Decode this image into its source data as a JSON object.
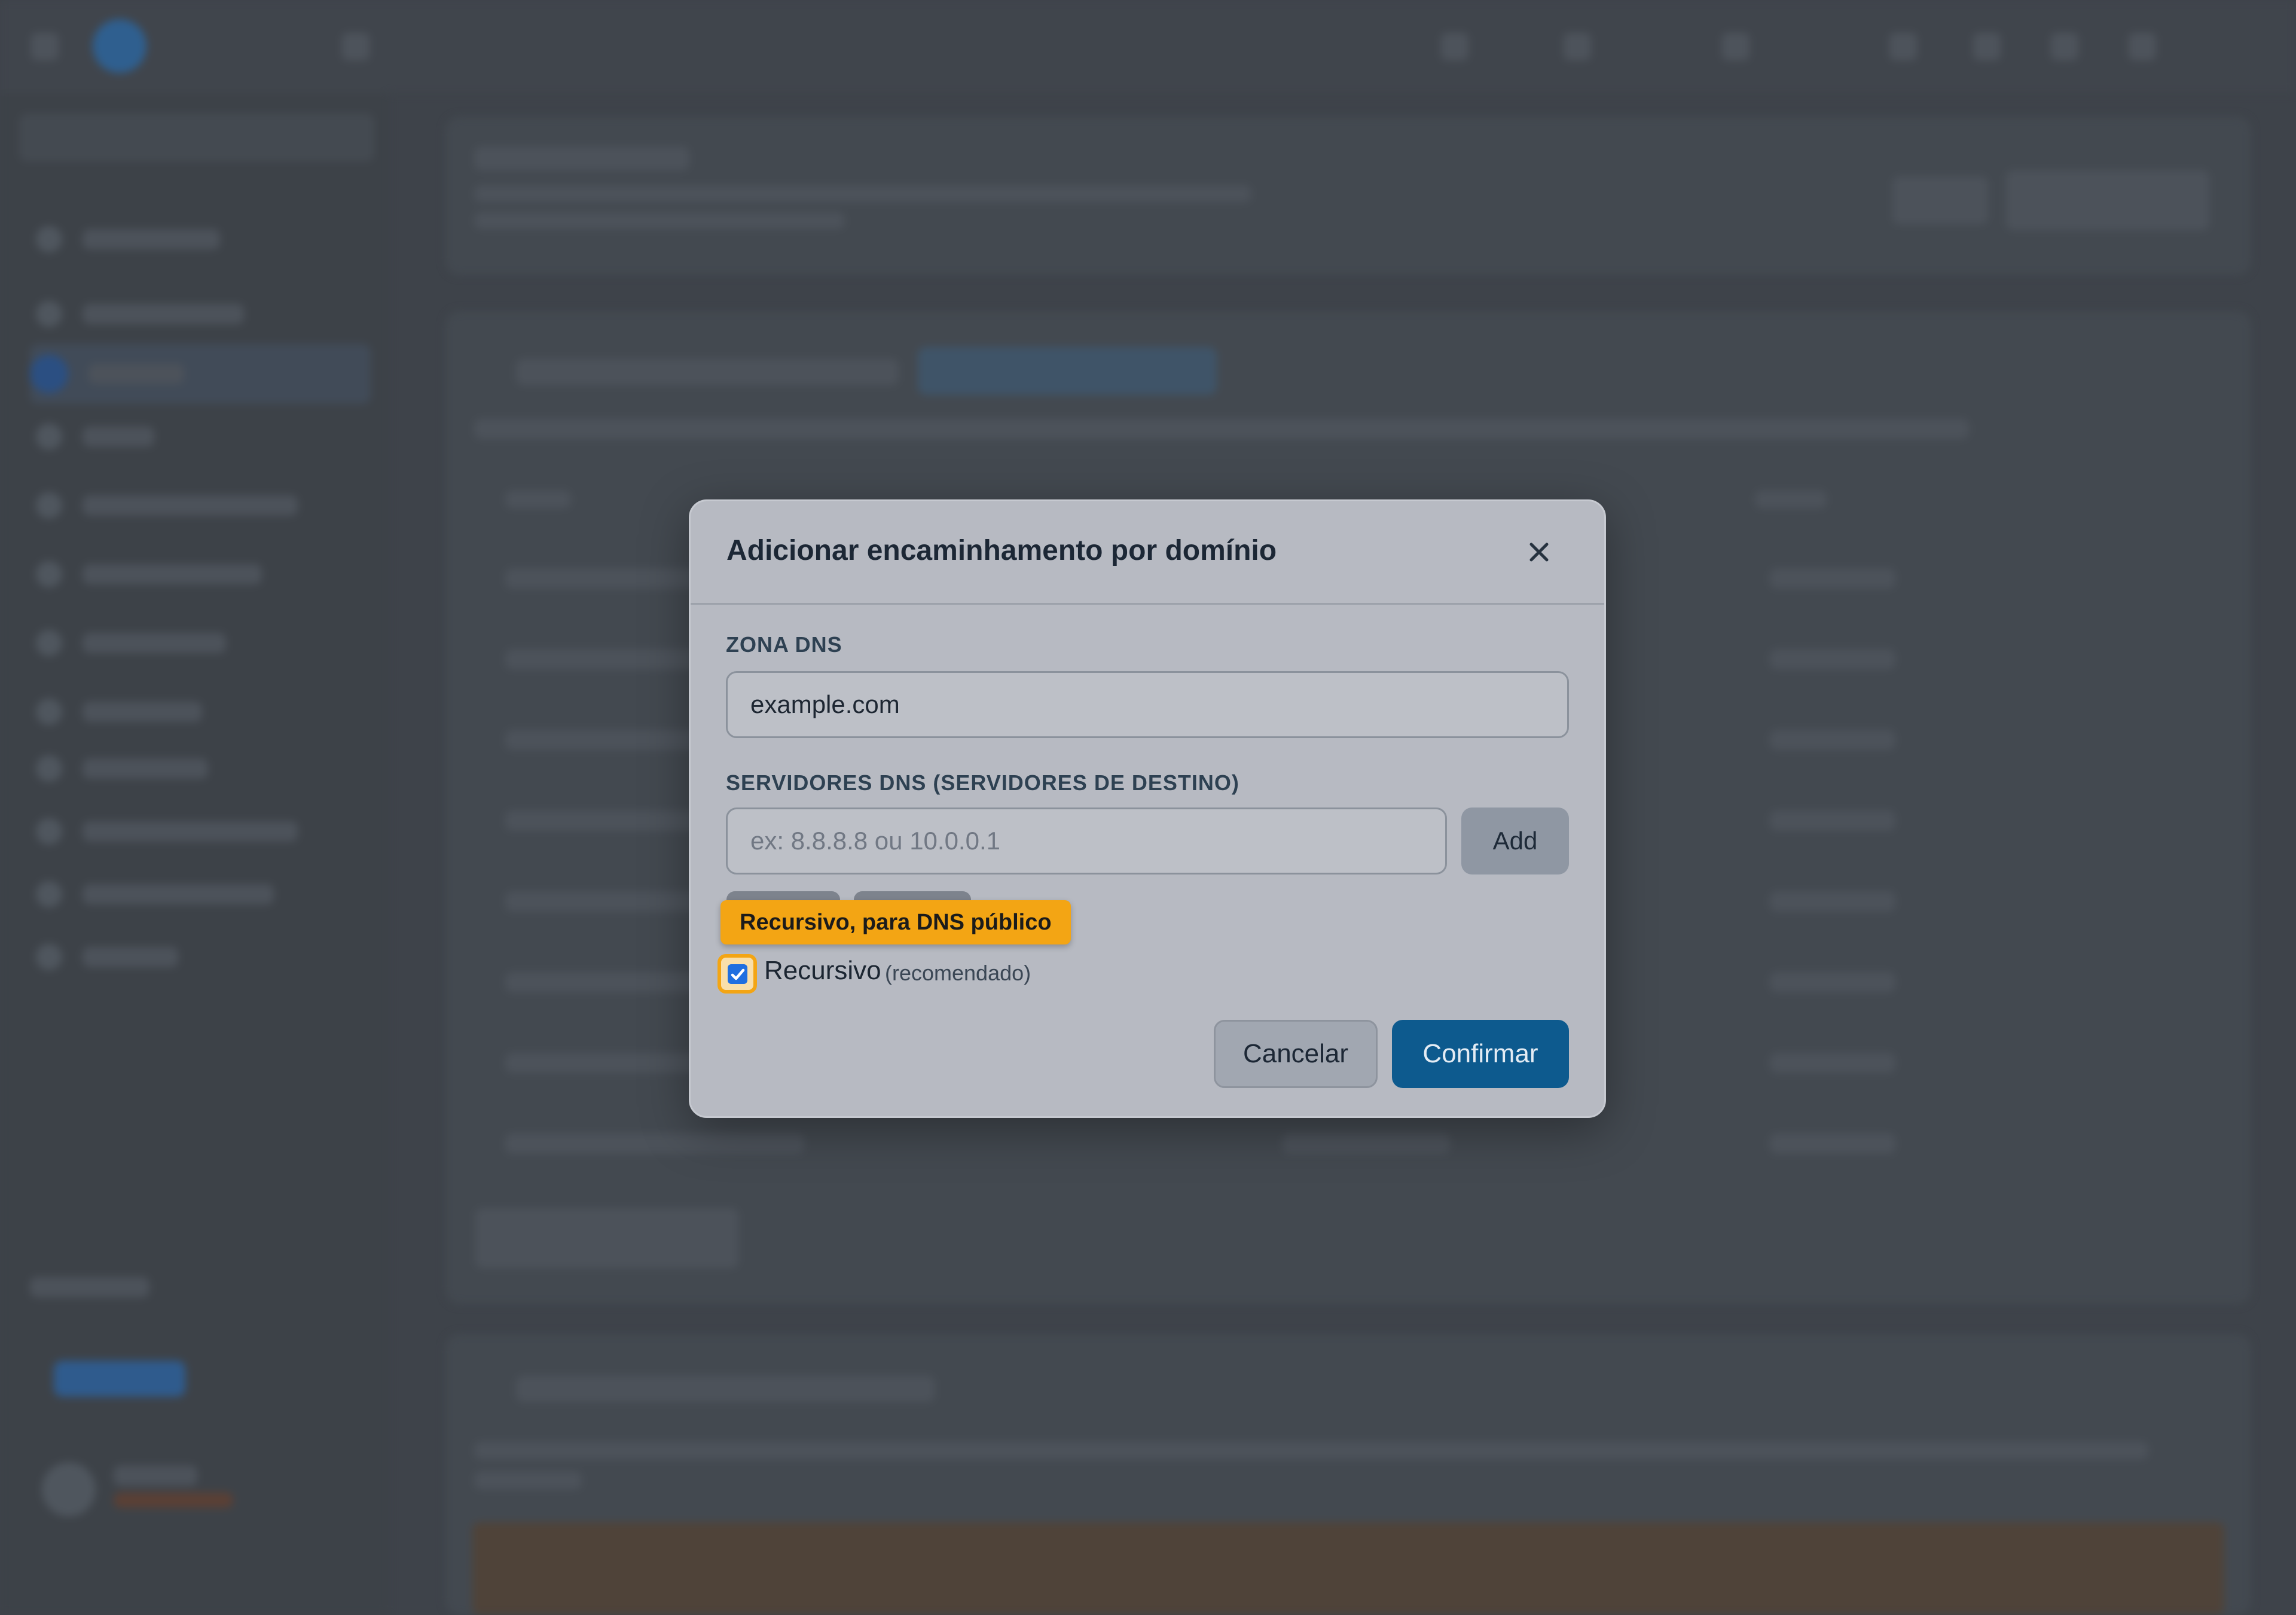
{
  "modal": {
    "title": "Adicionar encaminhamento por domínio",
    "zone_label": "ZONA DNS",
    "zone_value": "example.com",
    "servers_label": "SERVIDORES DNS (SERVIDORES DE DESTINO)",
    "servers_placeholder": "ex: 8.8.8.8 ou 10.0.0.1",
    "add_label": "Add",
    "tooltip": "Recursivo, para DNS público",
    "recursive_label": "Recursivo",
    "recursive_hint": "(recomendado)",
    "recursive_checked": true,
    "cancel_label": "Cancelar",
    "confirm_label": "Confirmar"
  },
  "icons": {
    "close": "close-icon",
    "check": "check-icon"
  },
  "colors": {
    "highlight": "#f3a514",
    "primary": "#0d5a8e",
    "checkbox": "#1f6fe0"
  }
}
